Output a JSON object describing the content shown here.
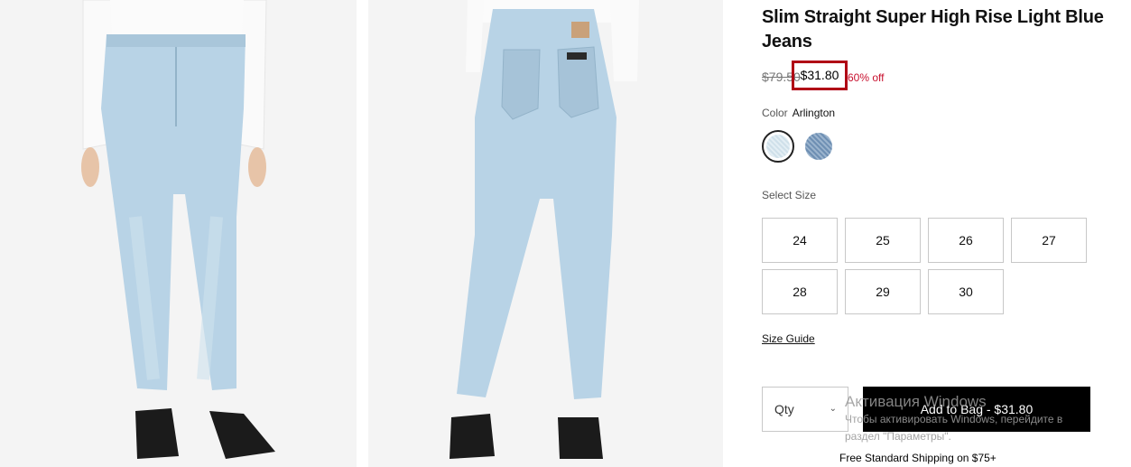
{
  "product": {
    "title": "Slim Straight Super High Rise Light Blue Jeans",
    "old_price": "$79.50",
    "sale_price": "$31.80",
    "discount": "60% off"
  },
  "color": {
    "label": "Color",
    "value": "Arlington",
    "swatches": [
      {
        "name": "Arlington",
        "icon": "light-denim-swatch",
        "selected": true
      },
      {
        "name": "dark-denim",
        "icon": "dark-denim-swatch",
        "selected": false
      }
    ]
  },
  "size": {
    "label": "Select Size",
    "options": [
      "24",
      "25",
      "26",
      "27",
      "28",
      "29",
      "30"
    ],
    "guide_label": "Size Guide"
  },
  "purchase": {
    "qty_label": "Qty",
    "add_to_bag_label": "Add to Bag - $31.80",
    "shipping_text": "Free Standard Shipping on $75+"
  },
  "overlay": {
    "line1": "Активация Windows",
    "line2": "Чтобы активировать Windows, перейдите в",
    "line3": "раздел \"Параметры\"."
  },
  "colors": {
    "highlight_border": "#b00015",
    "discount_red": "#c8102e",
    "button_bg": "#000000"
  }
}
